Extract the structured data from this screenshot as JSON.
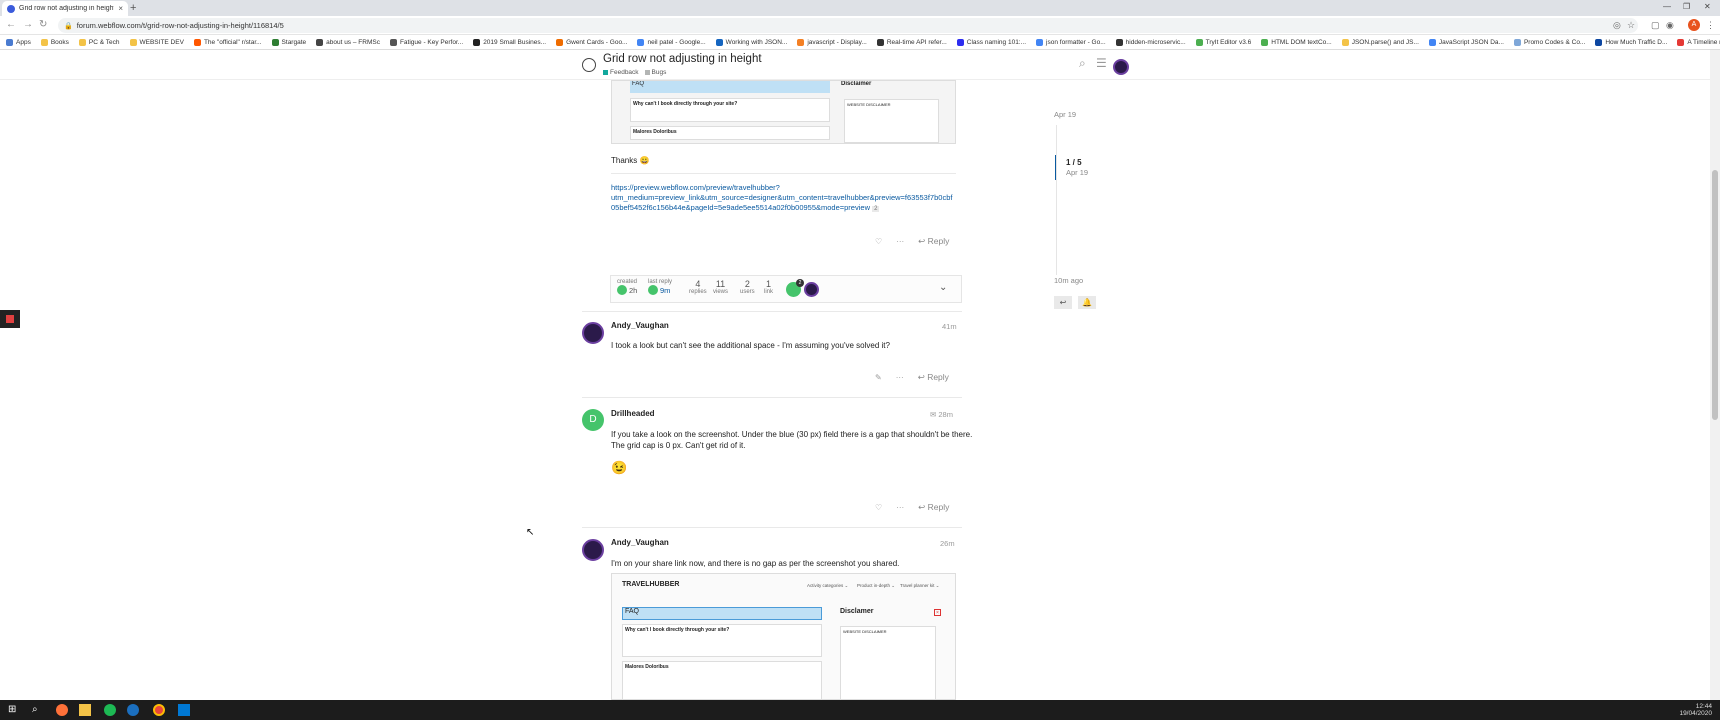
{
  "browser": {
    "tab_title": "Grid row not adjusting in height",
    "new_tab": "+",
    "url": "forum.webflow.com/t/grid-row-not-adjusting-in-height/116814/5",
    "profile_initial": "A",
    "bookmarks": [
      {
        "label": "Apps",
        "color": "#4a7bd0"
      },
      {
        "label": "Books",
        "color": "#f3c347"
      },
      {
        "label": "PC & Tech",
        "color": "#f3c347"
      },
      {
        "label": "WEBSITE DEV",
        "color": "#f3c347"
      },
      {
        "label": "The \"official\" r/star...",
        "color": "#ff5700"
      },
      {
        "label": "Stargate",
        "color": "#2e7d32"
      },
      {
        "label": "about us – FRMSc",
        "color": "#444"
      },
      {
        "label": "Fatigue - Key Perfor...",
        "color": "#555"
      },
      {
        "label": "2019 Small Busines...",
        "color": "#222"
      },
      {
        "label": "Gwent Cards - Goo...",
        "color": "#ef6c00"
      },
      {
        "label": "neil patel - Google...",
        "color": "#4285f4"
      },
      {
        "label": "Working with JSON...",
        "color": "#1565c0"
      },
      {
        "label": "javascript - Display...",
        "color": "#f48024"
      },
      {
        "label": "Real-time API refer...",
        "color": "#333"
      },
      {
        "label": "Class naming 101:...",
        "color": "#2d2df0"
      },
      {
        "label": "json formatter - Go...",
        "color": "#4285f4"
      },
      {
        "label": "hidden-microservic...",
        "color": "#333"
      },
      {
        "label": "TryIt Editor v3.6",
        "color": "#4caf50"
      },
      {
        "label": "HTML DOM textCo...",
        "color": "#4caf50"
      },
      {
        "label": "JSON.parse() and JS...",
        "color": "#f3c347"
      },
      {
        "label": "JavaScript JSON Da...",
        "color": "#4285f4"
      },
      {
        "label": "Promo Codes & Co...",
        "color": "#7fa7d8"
      },
      {
        "label": "How Much Traffic D...",
        "color": "#0d47a1"
      },
      {
        "label": "A Timeline made us...",
        "color": "#e53935"
      }
    ]
  },
  "header": {
    "title": "Grid row not adjusting in height",
    "categories": [
      {
        "label": "Feedback",
        "color": "#12a89d"
      },
      {
        "label": "Bugs",
        "color": "#b3b5b4"
      }
    ]
  },
  "first_post": {
    "thanks": "Thanks 😀",
    "link_lines": [
      "https://preview.webflow.com/preview/travelhubber?",
      "utm_medium=preview_link&utm_source=designer&utm_content=travelhubber&preview=f63553f7b0cbf",
      "05bef5452f6c156b44e&pageId=5e9ade5ee5514a02f0b00955&mode=preview"
    ],
    "link_count": "2",
    "reply_label": "Reply"
  },
  "topic_map": {
    "created_label": "created",
    "created_value": "2h",
    "last_reply_label": "last reply",
    "last_reply_value": "9m",
    "stats": [
      {
        "value": "4",
        "label": "replies"
      },
      {
        "value": "11",
        "label": "views"
      },
      {
        "value": "2",
        "label": "users"
      },
      {
        "value": "1",
        "label": "link"
      }
    ],
    "badge": "2"
  },
  "posts": [
    {
      "user": "Andy_Vaughan",
      "time": "41m",
      "body": "I took a look but can't see the additional space - I'm assuming you've solved it?",
      "reply_label": "Reply"
    },
    {
      "user": "Drillheaded",
      "time": "28m",
      "avatar_letter": "D",
      "body": "If you take a look on the screenshot. Under the blue (30 px) field there is a gap that shouldn't be there.",
      "body2": "The grid cap is 0 px. Can't get rid of it.",
      "emoji": "😉",
      "reply_label": "Reply"
    },
    {
      "user": "Andy_Vaughan",
      "time": "26m",
      "body": "I'm on your share link now, and there is no gap as per the screenshot you shared.",
      "reply_label": "Reply"
    }
  ],
  "screenshot_preview": {
    "brand": "TRAVELHUBBER",
    "nav": [
      "Activity categories ⌄",
      "Product in-depth ⌄",
      "Travel planner kit ⌄"
    ],
    "faq": "FAQ",
    "disclaimer": "Disclamer",
    "question": "Why can't I book directly through your site?",
    "question2": "Malores Doloribus",
    "website_disclaimer": "WEBSITE DISCLAIMER"
  },
  "top_thumb": {
    "faq": "FAQ",
    "disclaimer": "Disclaimer",
    "question": "Why can't I book directly through your site?",
    "question2": "Malores Doloribus",
    "website_disclaimer": "WEBSITE DISCLAIMER"
  },
  "timeline": {
    "top_date": "Apr 19",
    "position": "1 / 5",
    "position_date": "Apr 19",
    "bottom": "10m ago"
  },
  "taskbar": {
    "time": "12:44",
    "date": "19/04/2020"
  }
}
